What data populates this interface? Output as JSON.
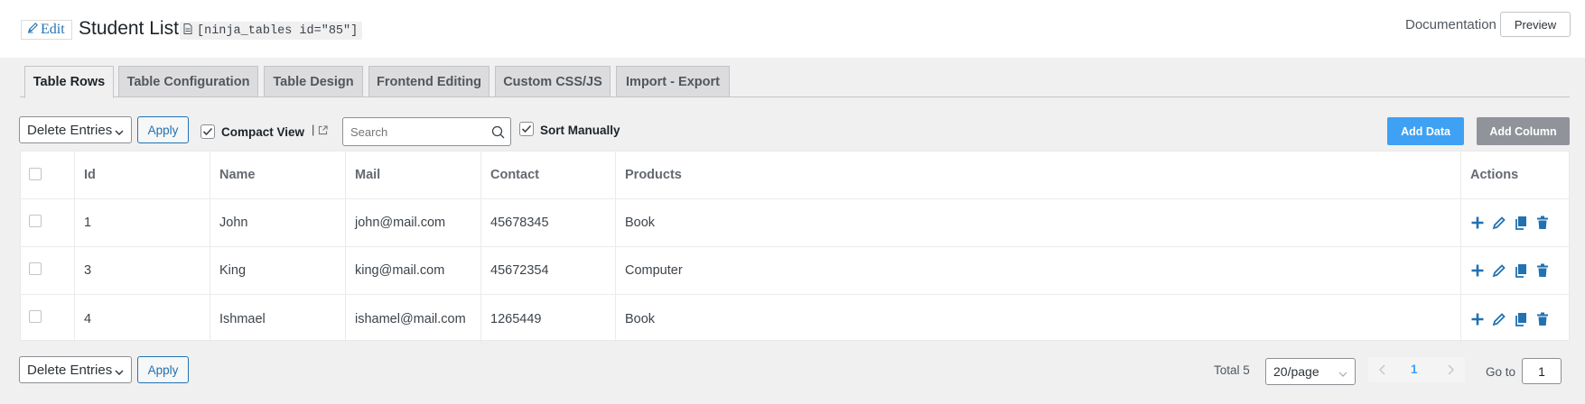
{
  "header": {
    "edit_label": "Edit",
    "title": "Student List",
    "shortcode": "[ninja_tables id=\"85\"]",
    "documentation": "Documentation",
    "preview": "Preview"
  },
  "tabs": [
    {
      "label": "Table Rows",
      "active": true
    },
    {
      "label": "Table Configuration",
      "active": false
    },
    {
      "label": "Table Design",
      "active": false
    },
    {
      "label": "Frontend Editing",
      "active": false
    },
    {
      "label": "Custom CSS/JS",
      "active": false
    },
    {
      "label": "Import - Export",
      "active": false
    }
  ],
  "toolbar": {
    "bulk_action": "Delete Entries",
    "apply": "Apply",
    "compact_view": {
      "label": "Compact View",
      "checked": true,
      "separator": "|"
    },
    "search_placeholder": "Search",
    "sort_manually": {
      "label": "Sort Manually",
      "checked": true
    },
    "add_data": "Add Data",
    "add_column": "Add Column"
  },
  "table": {
    "columns": [
      "Id",
      "Name",
      "Mail",
      "Contact",
      "Products",
      "Actions"
    ],
    "rows": [
      {
        "id": "1",
        "name": "John",
        "mail": "john@mail.com",
        "contact": "45678345",
        "products": "Book"
      },
      {
        "id": "3",
        "name": "King",
        "mail": "king@mail.com",
        "contact": "45672354",
        "products": "Computer"
      },
      {
        "id": "4",
        "name": "Ishmael",
        "mail": "ishamel@mail.com",
        "contact": "1265449",
        "products": "Book"
      }
    ],
    "row_actions": [
      "plus-icon",
      "pencil-icon",
      "copy-icon",
      "trash-icon"
    ]
  },
  "footer": {
    "bulk_action": "Delete Entries",
    "apply": "Apply",
    "total": "Total 5",
    "page_size": "20/page",
    "current_page": "1",
    "goto_label": "Go to",
    "goto_value": "1"
  },
  "colors": {
    "accent": "#2271b1",
    "add_data": "#3ea1f4",
    "add_column": "#909399",
    "pager_active": "#409eff"
  }
}
